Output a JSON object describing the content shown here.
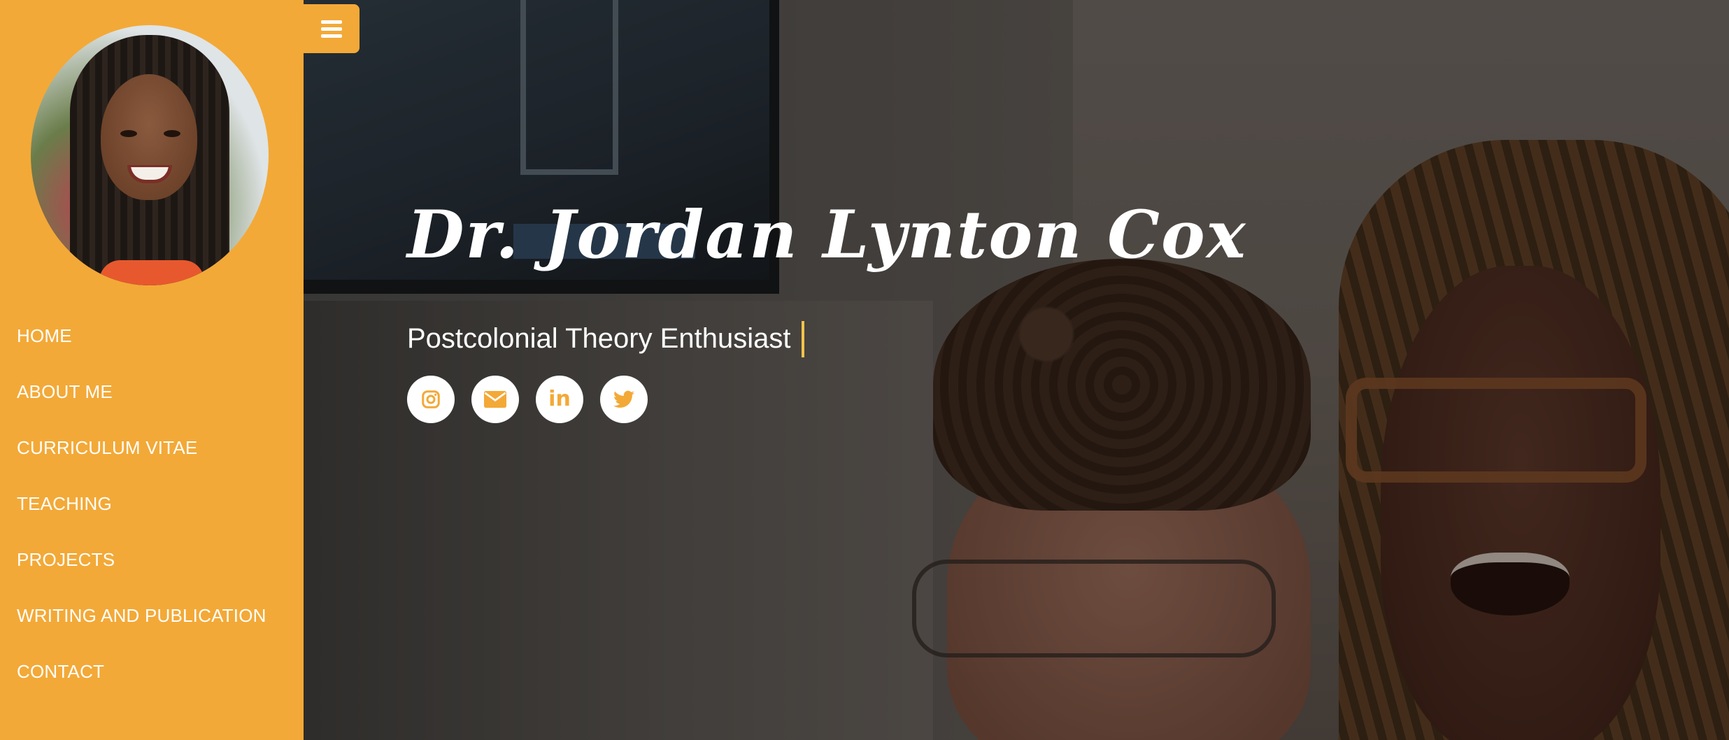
{
  "sidebar": {
    "nav": [
      {
        "label": "HOME"
      },
      {
        "label": "ABOUT ME"
      },
      {
        "label": "CURRICULUM VITAE"
      },
      {
        "label": "TEACHING"
      },
      {
        "label": "PROJECTS"
      },
      {
        "label": "WRITING AND PUBLICATION"
      },
      {
        "label": "CONTACT"
      }
    ]
  },
  "hero": {
    "name": "Dr. Jordan Lynton Cox",
    "subtitle": "Postcolonial Theory Enthusiast",
    "socials": [
      {
        "icon": "instagram-icon"
      },
      {
        "icon": "envelope-icon"
      },
      {
        "icon": "linkedin-icon",
        "glyph": "in"
      },
      {
        "icon": "twitter-icon"
      }
    ]
  },
  "colors": {
    "accent": "#f3a937",
    "cursor": "#f3c44a",
    "text": "#ffffff"
  },
  "menu_toggle": {
    "icon": "hamburger-icon"
  }
}
